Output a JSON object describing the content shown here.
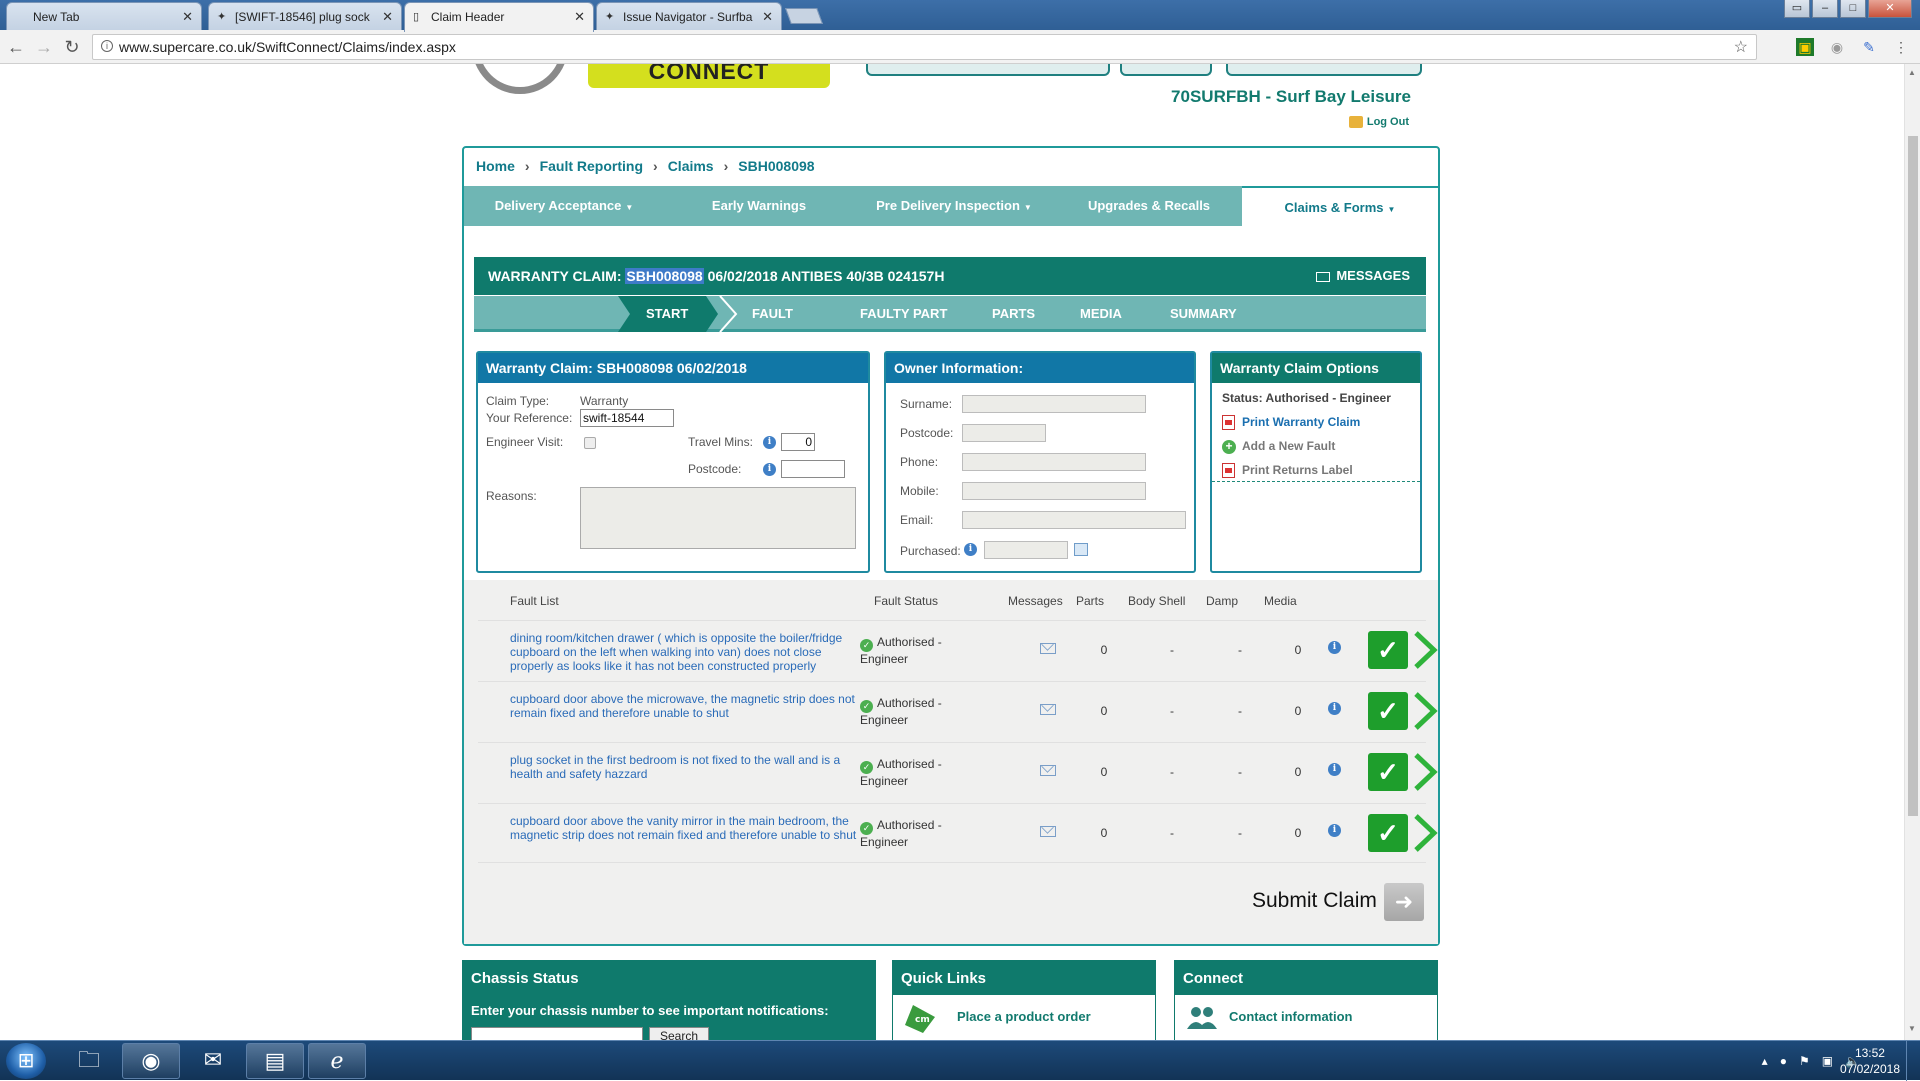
{
  "browser": {
    "tabs": [
      {
        "title": "New Tab",
        "icon": "blank"
      },
      {
        "title": "[SWIFT-18546] plug sock",
        "icon": "jira-icon"
      },
      {
        "title": "Claim Header",
        "icon": "page-icon",
        "active": true
      },
      {
        "title": "Issue Navigator - Surfba",
        "icon": "jira-icon"
      }
    ],
    "close_glyph": "✕",
    "url": "www.supercare.co.uk/SwiftConnect/Claims/index.aspx",
    "back": "←",
    "forward": "→",
    "reload": "↻",
    "star": "☆"
  },
  "header": {
    "brand_connect": "CONNECT",
    "dealer": "70SURFBH - Surf Bay Leisure",
    "logout": "Log Out"
  },
  "breadcrumb": {
    "items": [
      "Home",
      "Fault Reporting",
      "Claims",
      "SBH008098"
    ],
    "sep": "›"
  },
  "nav": {
    "items": [
      {
        "label": "Delivery Acceptance",
        "dropdown": true
      },
      {
        "label": "Early Warnings",
        "dropdown": false
      },
      {
        "label": "Pre Delivery Inspection",
        "dropdown": true
      },
      {
        "label": "Upgrades & Recalls",
        "dropdown": false
      },
      {
        "label": "Claims & Forms",
        "dropdown": true,
        "active": true
      }
    ],
    "caret": "▼"
  },
  "claim_bar": {
    "prefix": "WARRANTY CLAIM: ",
    "claim_no": "SBH008098",
    "suffix": " 06/02/2018 ANTIBES 40/3B 024157H",
    "messages": "MESSAGES"
  },
  "steps": [
    "START",
    "FAULT",
    "FAULTY PART",
    "PARTS",
    "MEDIA",
    "SUMMARY"
  ],
  "claim_panel": {
    "title": "Warranty Claim: SBH008098 06/02/2018",
    "claim_type_label": "Claim Type:",
    "claim_type_value": "Warranty",
    "your_ref_label": "Your Reference:",
    "your_ref_value": "swift-18544",
    "engineer_visit_label": "Engineer Visit:",
    "travel_mins_label": "Travel Mins:",
    "travel_mins_value": "0",
    "postcode_label": "Postcode:",
    "postcode_value": "",
    "reasons_label": "Reasons:"
  },
  "owner_panel": {
    "title": "Owner Information:",
    "surname_label": "Surname:",
    "postcode_label": "Postcode:",
    "phone_label": "Phone:",
    "mobile_label": "Mobile:",
    "email_label": "Email:",
    "purchased_label": "Purchased:"
  },
  "options_panel": {
    "title": "Warranty Claim Options",
    "status": "Status: Authorised - Engineer",
    "print_claim": "Print Warranty Claim",
    "add_fault": "Add a New Fault",
    "print_returns": "Print Returns Label"
  },
  "fault_list": {
    "headers": [
      "Fault List",
      "Fault Status",
      "Messages",
      "Parts",
      "Body Shell",
      "Damp",
      "Media"
    ],
    "rows": [
      {
        "desc": "dining room/kitchen drawer ( which is opposite the boiler/fridge cupboard on the left when walking into van) does not close properly as looks like it has not been constructed properly",
        "status": "Authorised - Engineer",
        "parts": "0",
        "body_shell": "-",
        "damp": "-",
        "media": "0"
      },
      {
        "desc": "cupboard door above the microwave, the magnetic strip does not remain fixed and therefore unable to shut",
        "status": "Authorised - Engineer",
        "parts": "0",
        "body_shell": "-",
        "damp": "-",
        "media": "0"
      },
      {
        "desc": "plug socket in the first bedroom is not fixed to the wall and is a health and safety hazzard",
        "status": "Authorised - Engineer",
        "parts": "0",
        "body_shell": "-",
        "damp": "-",
        "media": "0"
      },
      {
        "desc": "cupboard door above the vanity mirror in the main bedroom, the magnetic strip does not remain fixed and therefore unable to shut",
        "status": "Authorised - Engineer",
        "parts": "0",
        "body_shell": "-",
        "damp": "-",
        "media": "0"
      }
    ],
    "tick": "✓",
    "info": "i"
  },
  "submit": {
    "label": "Submit Claim",
    "arrow": "➜"
  },
  "bottom": {
    "chassis_title": "Chassis Status",
    "chassis_text": "Enter your chassis number to see important notifications:",
    "chassis_search": "Search",
    "quick_links_title": "Quick Links",
    "quick_link_1": "Place a product order",
    "connect_title": "Connect",
    "connect_link_1": "Contact information"
  },
  "taskbar": {
    "time": "13:52",
    "date": "07/02/2018"
  },
  "colors": {
    "teal_dark": "#0f7a6c",
    "teal_light": "#6fb6b4",
    "blue_head": "#1177a6",
    "link_blue": "#2a6bb8",
    "approve_green": "#1e9e2c",
    "connect_yellow": "#d4df1e"
  }
}
